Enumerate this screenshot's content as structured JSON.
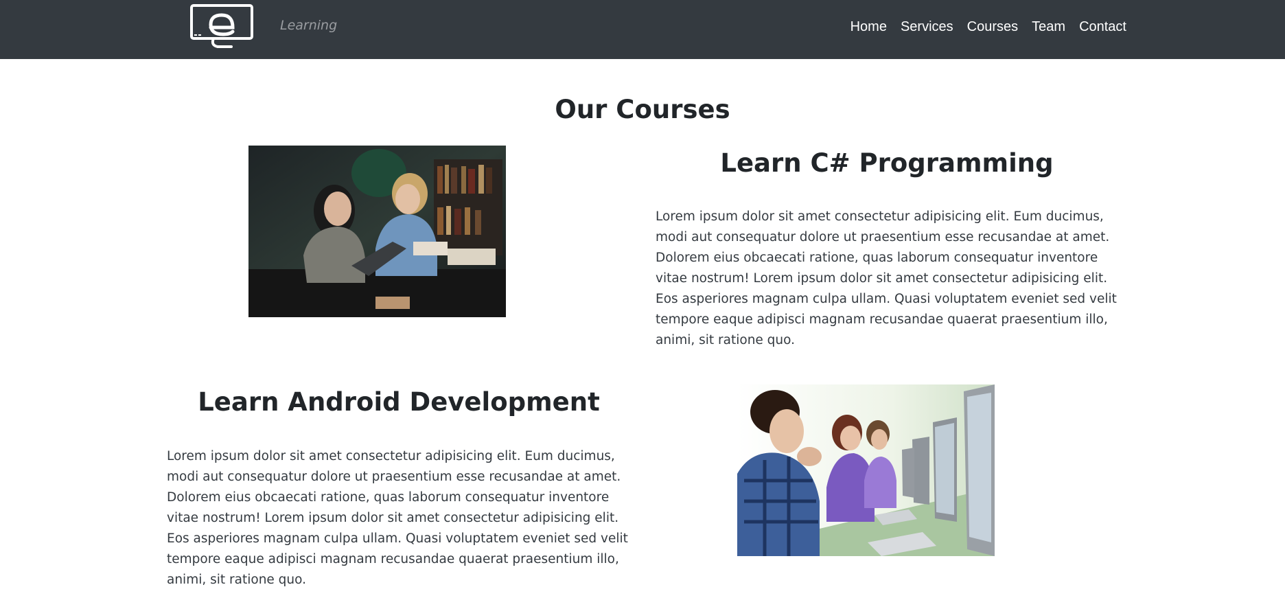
{
  "navbar": {
    "logo_icon": "e-monitor-logo-icon",
    "tagline": "Learning",
    "links": [
      "Home",
      "Services",
      "Courses",
      "Team",
      "Contact"
    ]
  },
  "page": {
    "title": "Our Courses"
  },
  "courses": [
    {
      "title": "Learn C# Programming",
      "description": "Lorem ipsum dolor sit amet consectetur adipisicing elit. Eum ducimus, modi aut consequatur dolore ut praesentium esse recusandae at amet. Dolorem eius obcaecati ratione, quas laborum consequatur inventore vitae nostrum! Lorem ipsum dolor sit amet consectetur adipisicing elit. Eos asperiores magnam culpa ullam. Quasi voluptatem eveniet sed velit tempore eaque adipisci magnam recusandae quaerat praesentium illo, animi, sit ratione quo.",
      "image": "students-studying-photo"
    },
    {
      "title": "Learn Android Development",
      "description": "Lorem ipsum dolor sit amet consectetur adipisicing elit. Eum ducimus, modi aut consequatur dolore ut praesentium esse recusandae at amet. Dolorem eius obcaecati ratione, quas laborum consequatur inventore vitae nostrum! Lorem ipsum dolor sit amet consectetur adipisicing elit. Eos asperiores magnam culpa ullam. Quasi voluptatem eveniet sed velit tempore eaque adipisci magnam recusandae quaerat praesentium illo, animi, sit ratione quo.",
      "image": "computer-lab-photo"
    }
  ],
  "colors": {
    "navbar_bg": "#343a40",
    "text": "#212529",
    "tagline": "#9a9da1"
  }
}
